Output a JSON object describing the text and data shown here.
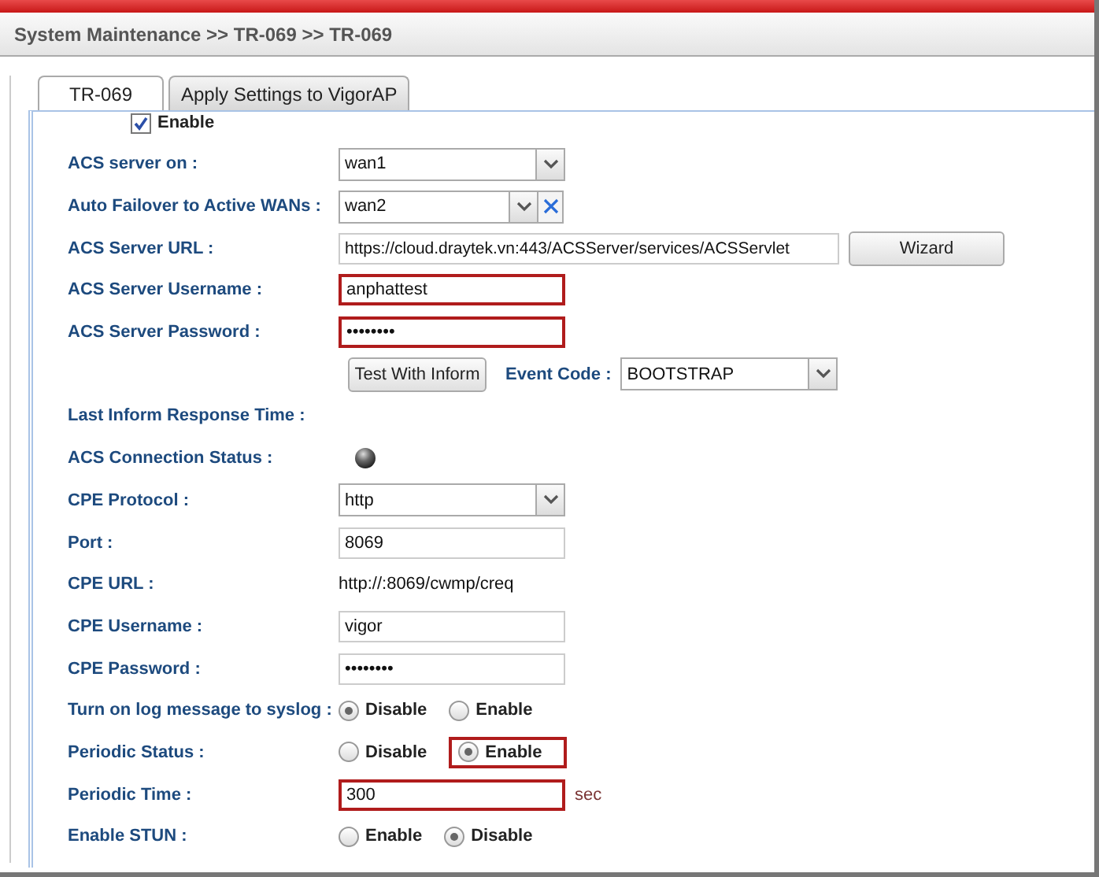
{
  "breadcrumb": "System Maintenance >> TR-069 >> TR-069",
  "tabs": [
    {
      "label": "TR-069",
      "selected": true
    },
    {
      "label": "Apply Settings to VigorAP",
      "selected": false
    }
  ],
  "rows": [
    {
      "kind": "checkbox",
      "label": "Enable",
      "checked": true
    },
    {
      "kind": "select",
      "label": "ACS server on :",
      "value": "wan1"
    },
    {
      "kind": "select_clear",
      "label": "Auto Failover to Active WANs :",
      "value": "wan2"
    },
    {
      "kind": "input_button",
      "label": "ACS Server URL :",
      "value": "https://cloud.draytek.vn:443/ACSServer/services/ACSServlet",
      "button": "Wizard"
    },
    {
      "kind": "input",
      "label": "ACS Server Username :",
      "value": "anphattest",
      "highlighted": true
    },
    {
      "kind": "input",
      "label": "ACS Server Password :",
      "value": "••••••••",
      "highlighted": true
    },
    {
      "kind": "button_select",
      "button": "Test With Inform",
      "label": "Event Code :",
      "value": "BOOTSTRAP"
    },
    {
      "kind": "label",
      "label": "Last Inform Response Time :"
    },
    {
      "kind": "status",
      "label": "ACS Connection Status :"
    },
    {
      "kind": "select",
      "label": "CPE Protocol :",
      "value": "http"
    },
    {
      "kind": "input",
      "label": "Port :",
      "value": "8069",
      "highlighted": false
    },
    {
      "kind": "text",
      "label": "CPE URL :",
      "value": "http://:8069/cwmp/creq"
    },
    {
      "kind": "input",
      "label": "CPE Username :",
      "value": "vigor",
      "highlighted": false
    },
    {
      "kind": "input",
      "label": "CPE Password :",
      "value": "••••••••",
      "highlighted": false
    },
    {
      "kind": "radio",
      "label": "Turn on log message to syslog :",
      "options": [
        {
          "label": "Disable",
          "selected": true,
          "highlighted": false
        },
        {
          "label": "Enable",
          "selected": false,
          "highlighted": false
        }
      ]
    },
    {
      "kind": "radio",
      "label": "Periodic Status :",
      "options": [
        {
          "label": "Disable",
          "selected": false,
          "highlighted": false
        },
        {
          "label": "Enable",
          "selected": true,
          "highlighted": true
        }
      ]
    },
    {
      "kind": "input_unit",
      "label": "Periodic Time :",
      "value": "300",
      "unit": "sec",
      "highlighted": true
    },
    {
      "kind": "radio",
      "label": "Enable STUN :",
      "options": [
        {
          "label": "Enable",
          "selected": false,
          "highlighted": false
        },
        {
          "label": "Disable",
          "selected": true,
          "highlighted": false
        }
      ]
    }
  ]
}
